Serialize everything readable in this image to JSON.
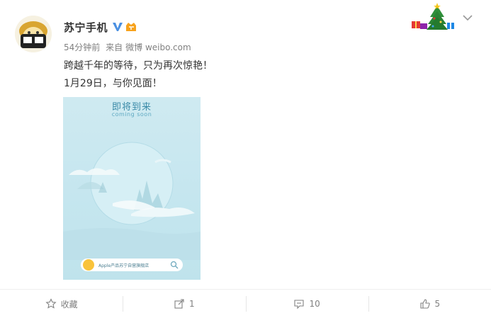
{
  "post": {
    "username": "苏宁手机",
    "time": "54分钟前",
    "source_prefix": "来自",
    "source": "微博 weibo.com",
    "text_line1": "跨越千年的等待，只为再次惊艳！",
    "text_line2": "1月29日，与你见面！"
  },
  "poster": {
    "title": "即将到来",
    "subtitle": "coming soon",
    "bar_text": "Apple产品苏宁自营旗舰店"
  },
  "actions": {
    "favorite_label": "收藏",
    "repost_count": "1",
    "comment_count": "10",
    "like_count": "5"
  },
  "colors": {
    "username": "#333333",
    "meta": "#808080",
    "verified": "#4a90e2",
    "poster_bg": "#c5e6ef",
    "poster_title": "#3a8aa8"
  },
  "icons": [
    "avatar",
    "verified-icon",
    "vip-icon",
    "christmas-decoration",
    "chevron-down-icon",
    "star-icon",
    "repost-icon",
    "comment-icon",
    "like-icon",
    "search-icon"
  ]
}
